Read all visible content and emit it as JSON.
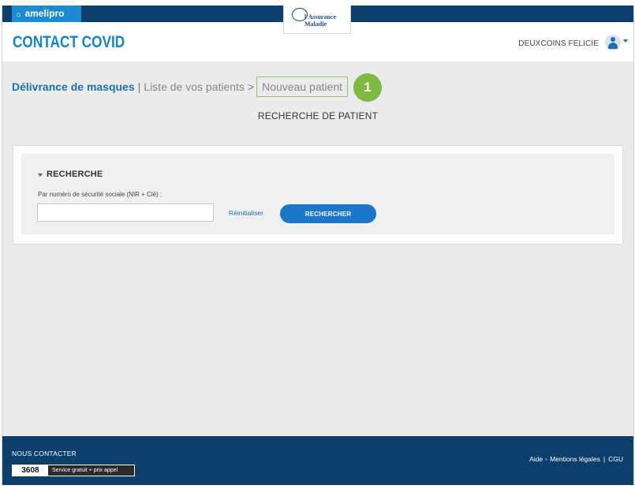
{
  "topbar": {
    "portal_label": "amelipro",
    "logo_line1": "l'Assurance",
    "logo_line2": "Maladie"
  },
  "header": {
    "app_title": "CONTACT COVID",
    "user_name": "DEUXCOINS FELICIE"
  },
  "breadcrumb": {
    "items": [
      "Délivrance de masques",
      "Liste de vos patients",
      "Nouveau patient"
    ],
    "sep1": "|",
    "sep2": ">"
  },
  "step_badge": "1",
  "page_title": "RECHERCHE DE PATIENT",
  "search": {
    "section_label": "RECHERCHE",
    "field_label": "Par numéro de sécurité sociale (NIR + Clé) :",
    "input_value": "",
    "reset_label": "Réinitialiser",
    "submit_label": "RECHERCHER"
  },
  "footer": {
    "contact_title": "NOUS CONTACTER",
    "phone_number": "3608",
    "phone_note": "Service gratuit + prix appel",
    "links": [
      "Aide",
      "Mentions légales",
      "CGU"
    ]
  },
  "colors": {
    "brand_dark": "#0c3f6b",
    "brand_blue": "#1486c8",
    "button_blue": "#1a77c9",
    "highlight_green": "#7eba3f"
  },
  "icons": [
    "home-icon",
    "user-avatar-icon",
    "chevron-down-icon",
    "caret-down-icon"
  ]
}
